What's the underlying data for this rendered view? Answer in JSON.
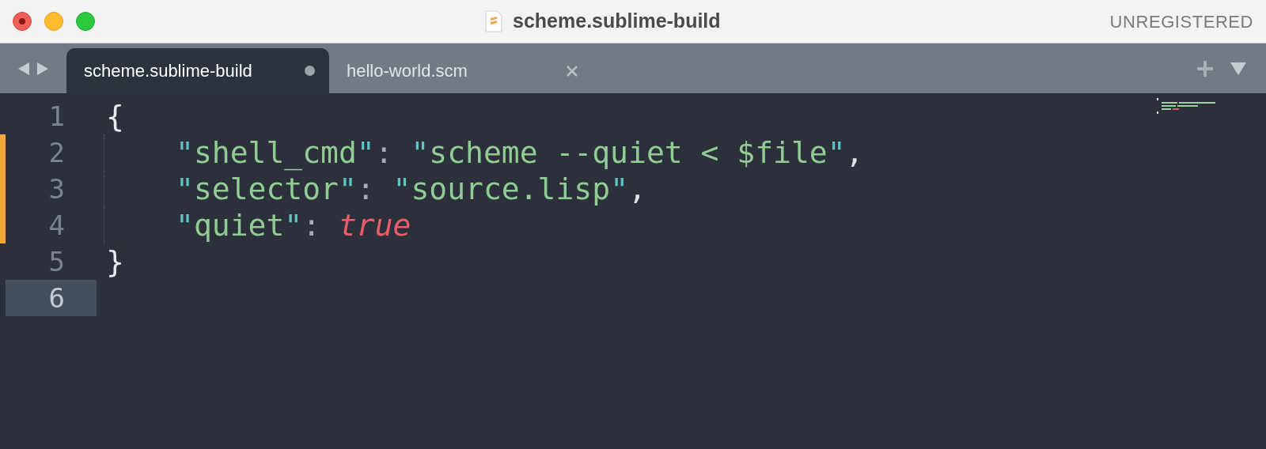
{
  "window": {
    "title": "scheme.sublime-build",
    "license": "UNREGISTERED"
  },
  "tabs": [
    {
      "label": "scheme.sublime-build",
      "selected": true,
      "modified": true
    },
    {
      "label": "hello-world.scm",
      "selected": false,
      "modified": false
    }
  ],
  "editor": {
    "lines": [
      {
        "number": "1",
        "modified": false,
        "current": false,
        "indented": false,
        "tokens": [
          {
            "kind": "brace",
            "text": "{"
          }
        ]
      },
      {
        "number": "2",
        "modified": true,
        "current": false,
        "indented": true,
        "tokens": [
          {
            "kind": "quote",
            "text": "\""
          },
          {
            "kind": "key",
            "text": "shell_cmd"
          },
          {
            "kind": "quote",
            "text": "\""
          },
          {
            "kind": "colon",
            "text": ": "
          },
          {
            "kind": "quote",
            "text": "\""
          },
          {
            "kind": "string",
            "text": "scheme --quiet < $file"
          },
          {
            "kind": "quote",
            "text": "\""
          },
          {
            "kind": "comma",
            "text": ","
          }
        ]
      },
      {
        "number": "3",
        "modified": true,
        "current": false,
        "indented": true,
        "tokens": [
          {
            "kind": "quote",
            "text": "\""
          },
          {
            "kind": "key",
            "text": "selector"
          },
          {
            "kind": "quote",
            "text": "\""
          },
          {
            "kind": "colon",
            "text": ": "
          },
          {
            "kind": "quote",
            "text": "\""
          },
          {
            "kind": "string",
            "text": "source.lisp"
          },
          {
            "kind": "quote",
            "text": "\""
          },
          {
            "kind": "comma",
            "text": ","
          }
        ]
      },
      {
        "number": "4",
        "modified": true,
        "current": false,
        "indented": true,
        "tokens": [
          {
            "kind": "quote",
            "text": "\""
          },
          {
            "kind": "key",
            "text": "quiet"
          },
          {
            "kind": "quote",
            "text": "\""
          },
          {
            "kind": "colon",
            "text": ": "
          },
          {
            "kind": "bool",
            "text": "true"
          }
        ]
      },
      {
        "number": "5",
        "modified": false,
        "current": false,
        "indented": false,
        "tokens": [
          {
            "kind": "brace",
            "text": "}"
          }
        ]
      },
      {
        "number": "6",
        "modified": false,
        "current": true,
        "indented": false
      }
    ]
  }
}
